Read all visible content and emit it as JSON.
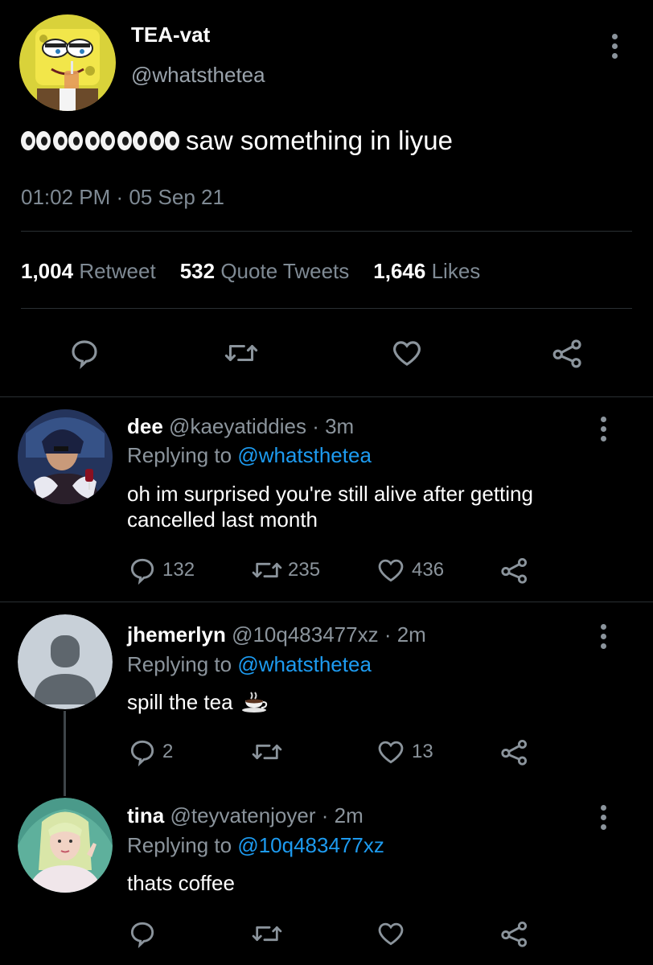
{
  "main_tweet": {
    "display_name": "TEA-vat",
    "handle": "@whatsthetea",
    "text": "saw something in liyue",
    "timestamp": "01:02 PM · 05 Sep 21",
    "stats": {
      "retweets_count": "1,004",
      "retweets_label": "Retweet",
      "quotes_count": "532",
      "quotes_label": "Quote Tweets",
      "likes_count": "1,646",
      "likes_label": "Likes"
    }
  },
  "replies": [
    {
      "display_name": "dee",
      "handle_time": "@kaeyatiddies · 3m",
      "replying_prefix": "Replying to",
      "replying_to": "@whatsthetea",
      "text": "oh im surprised you're still alive after getting cancelled last month",
      "replies": "132",
      "retweets": "235",
      "likes": "436"
    },
    {
      "display_name": "jhemerlyn",
      "handle_time": "@10q483477xz · 2m",
      "replying_prefix": "Replying to",
      "replying_to": "@whatsthetea",
      "text": "spill the tea",
      "replies": "2",
      "retweets": "",
      "likes": "13"
    },
    {
      "display_name": "tina",
      "handle_time": "@teyvatenjoyer · 2m",
      "replying_prefix": "Replying to",
      "replying_to": "@10q483477xz",
      "text": "thats coffee",
      "replies": "",
      "retweets": "",
      "likes": ""
    }
  ],
  "icons": {
    "reply": "comment-bubble-icon",
    "retweet": "retweet-icon",
    "like": "heart-icon",
    "share": "share-icon",
    "more": "vertical-dots-icon"
  },
  "colors": {
    "background": "#000000",
    "link": "#1d9bf0",
    "muted": "#8b949c"
  }
}
